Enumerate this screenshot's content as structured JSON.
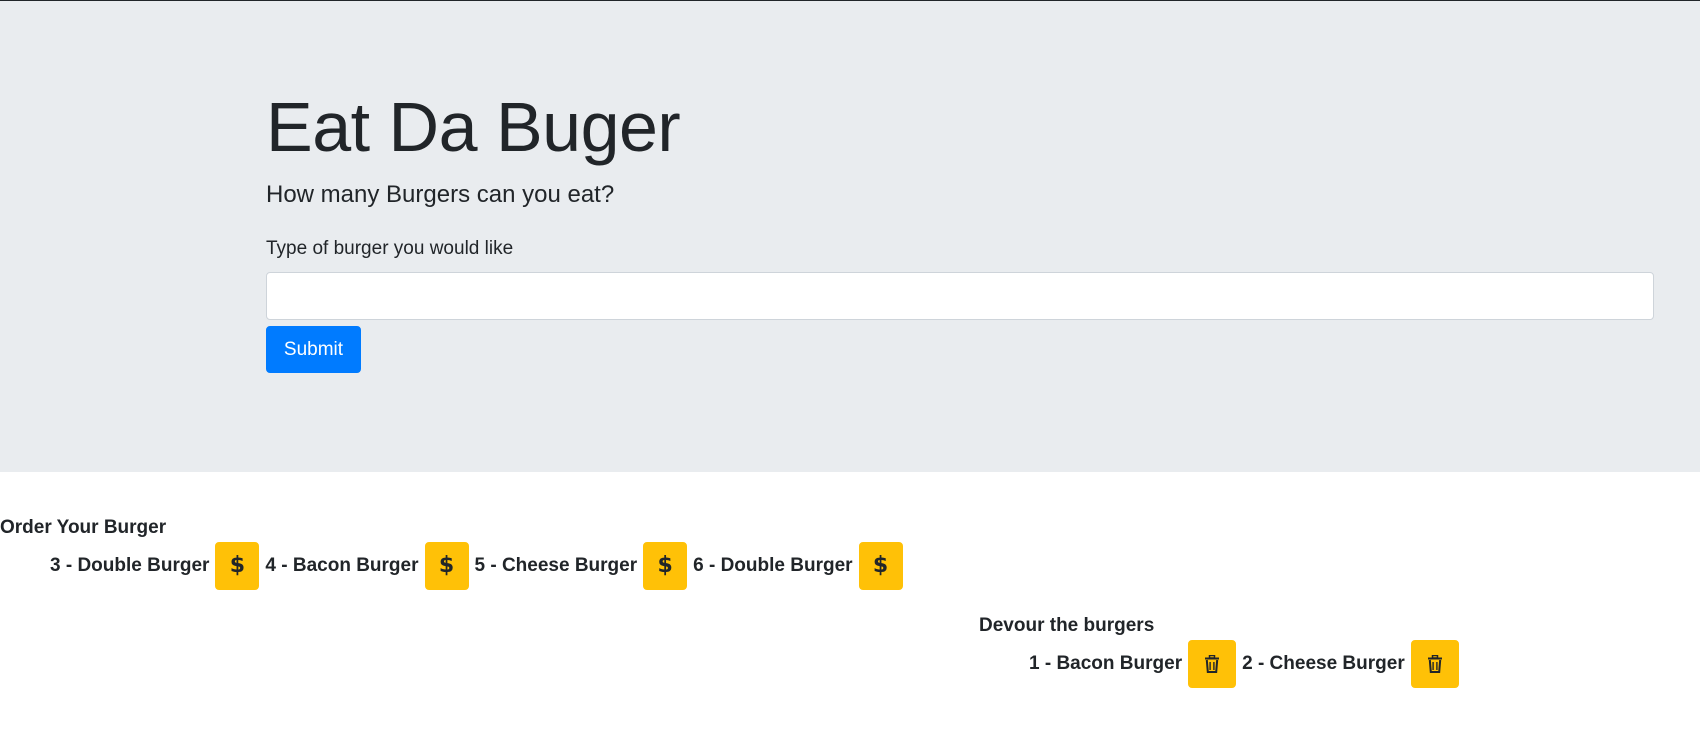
{
  "header": {
    "title": "Eat Da Buger",
    "subtitle": "How many Burgers can you eat?",
    "form": {
      "label": "Type of burger you would like",
      "input_value": "",
      "submit_label": "Submit"
    }
  },
  "order_section": {
    "heading": "Order Your Burger",
    "items": [
      {
        "label": "3 - Double Burger",
        "icon": "dollar-icon"
      },
      {
        "label": "4 - Bacon Burger",
        "icon": "dollar-icon"
      },
      {
        "label": "5 - Cheese Burger",
        "icon": "dollar-icon"
      },
      {
        "label": "6 - Double Burger",
        "icon": "dollar-icon"
      }
    ]
  },
  "devour_section": {
    "heading": "Devour the burgers",
    "items": [
      {
        "label": "1 - Bacon Burger",
        "icon": "trash-icon"
      },
      {
        "label": "2 - Cheese Burger",
        "icon": "trash-icon"
      }
    ]
  },
  "colors": {
    "jumbotron_bg": "#e9ecef",
    "primary": "#007bff",
    "warning": "#ffc107",
    "text": "#212529"
  }
}
